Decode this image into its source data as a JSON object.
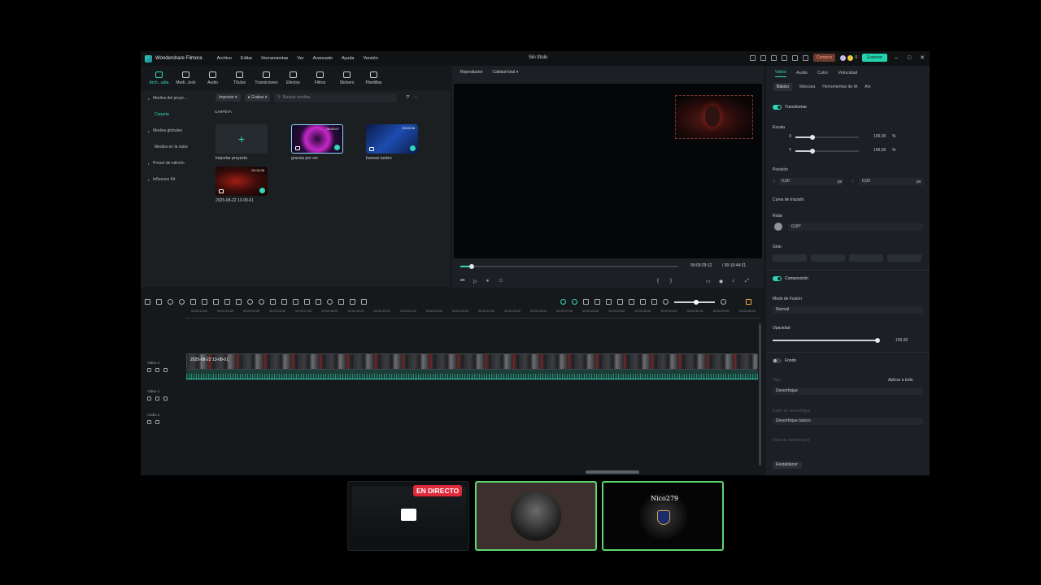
{
  "titlebar": {
    "app_name": "Wondershare Filmora",
    "menu": [
      "Archivo",
      "Editar",
      "Herramientas",
      "Ver",
      "Avanzado",
      "Ayuda",
      "Versión"
    ],
    "window_title": "Sin título",
    "buy_label": "Comprar",
    "export_label": "Exportar",
    "badge_count": "0"
  },
  "toolbar": [
    "Arch...adia",
    "Medi...tock",
    "Audio",
    "Títulos",
    "Transiciones",
    "Efectos",
    "Filtros",
    "Stickers",
    "Plantillas"
  ],
  "sidebar": {
    "items": [
      {
        "label": "Medios del proye...",
        "caret": true
      },
      {
        "label": "Carpeta",
        "active": true
      },
      {
        "label": "Medios globales",
        "caret": true
      },
      {
        "label": "Medios en la nube"
      },
      {
        "label": "Preset de edición",
        "caret": true
      },
      {
        "label": "Influence Kit",
        "caret": true
      }
    ]
  },
  "media": {
    "import_label": "Importar",
    "record_label": "Grabar",
    "search_placeholder": "Buscar medios",
    "folder_label": "CARPETA",
    "cards": [
      {
        "caption": "Importar proyecto"
      },
      {
        "caption": "gracias por ver",
        "duration": "00:00:07"
      },
      {
        "caption": "buenas tardes",
        "duration": "00:00:08"
      },
      {
        "caption": "2025-08-22 13-08-01",
        "duration": "00:10:28"
      }
    ]
  },
  "player": {
    "tab": "Reproductor",
    "quality": "Calidad total",
    "current_time": "00:00:29:12",
    "total_time": "/  00:10:44:21",
    "progress": 0.045
  },
  "inspector": {
    "tabs": [
      "Video",
      "Audio",
      "Color",
      "Velocidad"
    ],
    "subtabs": [
      "Básico",
      "Máscara",
      "Herramientas de IA",
      "Ani"
    ],
    "transform_label": "Transformar",
    "scale_label": "Escala",
    "scale_x_axis": "X",
    "scale_y_axis": "Y",
    "scale_x": "100,00",
    "scale_y": "100,00",
    "scale_unit": "%",
    "position_label": "Posición",
    "pos_x_axis": "X",
    "pos_y_axis": "Y",
    "pos_x": "0,00",
    "pos_y": "0,00",
    "pos_unit": "px",
    "curve_label": "Curva de trazado",
    "rotate_label": "Rotar",
    "rotate_value": "0,00°",
    "flip_label": "Girar",
    "composition_label": "Composición",
    "blend_label": "Modo de Fusión",
    "blend_value": "Normal",
    "opacity_label": "Opacidad",
    "opacity_value": "100,00",
    "background_label": "Fondo",
    "type_label": "Tipo",
    "apply_all": "Aplicar a todo",
    "blur_value": "Desenfoque",
    "blur_style_label": "Estilo de desenfoque",
    "blur_style_value": "Desenfoque básico",
    "blur_level_label": "Nivel de desenfoque",
    "reset_label": "Restablecer"
  },
  "timeline": {
    "ruler": [
      "00:00:13:00",
      "00:00:14:00",
      "00:00:15:00",
      "00:00:16:00",
      "00:00:17:00",
      "00:00:18:00",
      "00:00:19:00",
      "00:00:20:00",
      "00:00:21:00",
      "00:00:22:00",
      "00:00:23:00",
      "00:00:24:00",
      "00:00:25:00",
      "00:00:26:00",
      "00:00:27:00",
      "00:00:28:00",
      "00:00:29:00",
      "00:00:30:00",
      "00:00:31:00",
      "00:00:32:00",
      "00:00:33:00",
      "00:00:34:00"
    ],
    "tracks": [
      "Video 2",
      "Video 1",
      "Audio 1"
    ],
    "clip_name": "2025-08-22 13-08-01"
  },
  "stream": {
    "live_label": "EN DIRECTO",
    "channel_name": "Nico279"
  }
}
